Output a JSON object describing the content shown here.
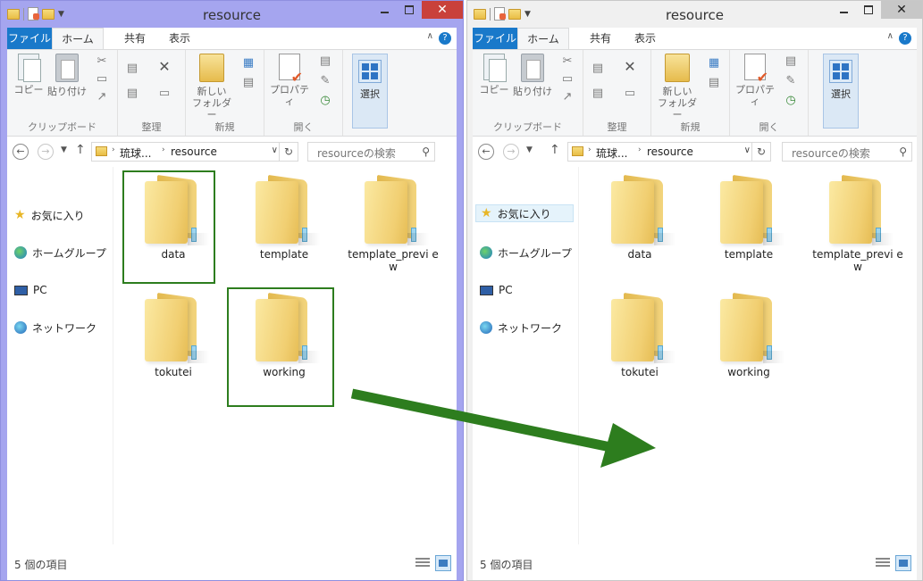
{
  "window_title": "resource",
  "ribbon": {
    "tabs": {
      "file": "ファイル",
      "home": "ホーム",
      "share": "共有",
      "view": "表示"
    },
    "clipboard": {
      "copy": "コピー",
      "paste": "貼り付け",
      "group": "クリップボード"
    },
    "organize": {
      "group": "整理"
    },
    "new": {
      "new_folder_line1": "新しい",
      "new_folder_line2": "フォルダー",
      "group": "新規"
    },
    "open": {
      "properties": "プロパティ",
      "group": "開く"
    },
    "select": {
      "label": "選択"
    }
  },
  "address": {
    "crumbs": [
      "琉球...",
      "resource"
    ],
    "search_placeholder": "resourceの検索"
  },
  "nav": {
    "favorites": "お気に入り",
    "homegroup": "ホームグループ",
    "pc": "PC",
    "network": "ネットワーク"
  },
  "items": [
    "data",
    "template",
    "template_previ ew",
    "tokutei",
    "working"
  ],
  "status": "5 個の項目",
  "colors": {
    "highlight_box": "#2d7d1e",
    "arrow": "#2d7d1e",
    "active_border": "#8f8fe0",
    "file_tab": "#1979ca"
  },
  "icons": {
    "folder": "folder-icon",
    "favorites": "star-icon",
    "homegroup": "homegroup-icon",
    "pc": "pc-icon",
    "network": "network-icon"
  }
}
